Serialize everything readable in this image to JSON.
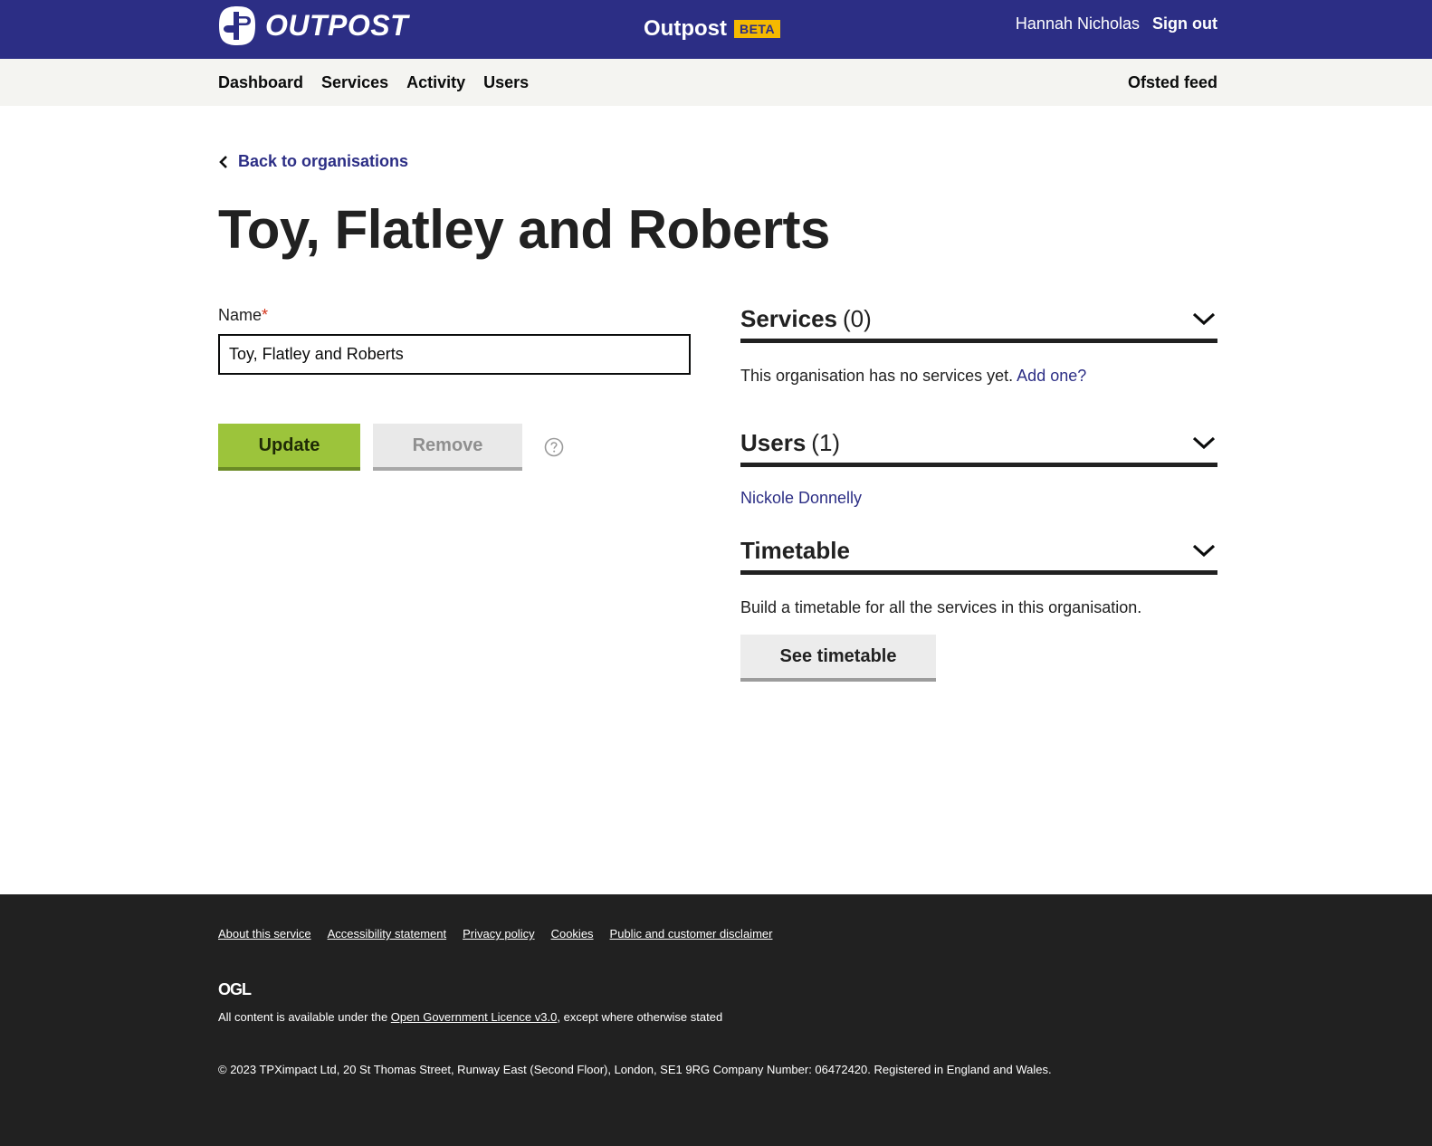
{
  "header": {
    "logo_text": "OUTPOST",
    "service_title": "Outpost",
    "beta_badge": "BETA",
    "user_name": "Hannah Nicholas",
    "sign_out": "Sign out"
  },
  "nav": {
    "items": [
      {
        "label": "Dashboard"
      },
      {
        "label": "Services"
      },
      {
        "label": "Activity"
      },
      {
        "label": "Users"
      }
    ],
    "right_item": "Ofsted feed"
  },
  "main": {
    "back_link": "Back to organisations",
    "page_title": "Toy, Flatley and Roberts",
    "form": {
      "name_label": "Name",
      "required_marker": "*",
      "name_value": "Toy, Flatley and Roberts",
      "update_label": "Update",
      "remove_label": "Remove"
    },
    "panels": {
      "services": {
        "title": "Services",
        "count": "(0)",
        "empty_text": "This organisation has no services yet.",
        "add_link": "Add one?"
      },
      "users": {
        "title": "Users",
        "count": "(1)",
        "items": [
          {
            "name": "Nickole Donnelly"
          }
        ]
      },
      "timetable": {
        "title": "Timetable",
        "description": "Build a timetable for all the services in this organisation.",
        "button_label": "See timetable"
      }
    }
  },
  "footer": {
    "links": [
      {
        "label": "About this service"
      },
      {
        "label": "Accessibility statement"
      },
      {
        "label": "Privacy policy"
      },
      {
        "label": "Cookies"
      },
      {
        "label": "Public and customer disclaimer"
      }
    ],
    "ogl_logo": "OGL",
    "licence_prefix": "All content is available under the ",
    "licence_link": "Open Government Licence v3.0",
    "licence_suffix": ", except where otherwise stated",
    "copyright": "© 2023 TPXimpact Ltd, 20 St Thomas Street, Runway East (Second Floor), London, SE1 9RG Company Number: 06472420. Registered in England and Wales."
  },
  "colors": {
    "header_bg": "#2c2e85",
    "beta_badge": "#f5b900",
    "update_button": "#9cc43b",
    "link": "#2c2e85",
    "footer_bg": "#212121"
  }
}
